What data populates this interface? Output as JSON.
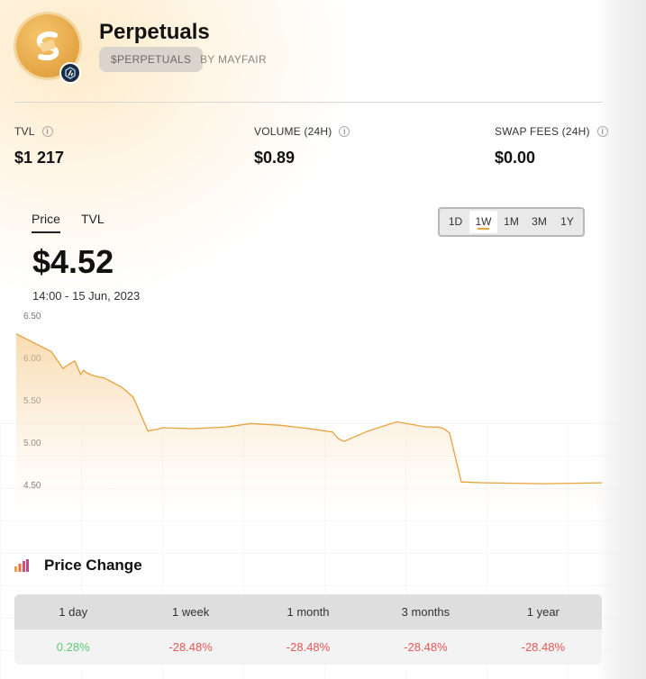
{
  "header": {
    "title": "Perpetuals",
    "ticker": "$PERPETUALS",
    "by": "BY MAYFAIR",
    "logo_icon": "perpetuals-logo",
    "chain_icon": "arbitrum-icon",
    "accent_color": "#e6a23c"
  },
  "stats": [
    {
      "label": "TVL",
      "value": "$1 217"
    },
    {
      "label": "VOLUME (24H)",
      "value": "$0.89"
    },
    {
      "label": "SWAP FEES (24H)",
      "value": "$0.00"
    }
  ],
  "chart_tabs": [
    "Price",
    "TVL"
  ],
  "ranges": [
    "1D",
    "1W",
    "1M",
    "3M",
    "1Y"
  ],
  "active_range": "1W",
  "price": {
    "current": "$4.52",
    "timestamp": "14:00 - 15 Jun, 2023"
  },
  "chart_data": {
    "type": "area",
    "y_ticks": [
      "6.50",
      "6.00",
      "5.50",
      "5.00",
      "4.50"
    ],
    "ylim": [
      4.45,
      6.55
    ],
    "xlabel": "",
    "ylabel": "",
    "line_color": "#e6a23c",
    "series": [
      {
        "x": [
          0,
          0.06,
          0.08,
          0.09,
          0.1,
          0.11,
          0.115,
          0.12,
          0.13,
          0.14,
          0.15,
          0.18,
          0.2,
          0.22,
          0.225,
          0.23,
          0.24,
          0.25,
          0.3,
          0.36,
          0.4,
          0.45,
          0.5,
          0.52,
          0.54,
          0.55,
          0.56,
          0.6,
          0.65,
          0.7,
          0.72,
          0.73,
          0.74,
          0.76,
          0.8,
          0.9,
          1.0
        ],
        "values": [
          6.28,
          6.07,
          5.87,
          5.92,
          5.96,
          5.8,
          5.85,
          5.82,
          5.79,
          5.77,
          5.76,
          5.65,
          5.53,
          5.21,
          5.13,
          5.14,
          5.15,
          5.17,
          5.16,
          5.18,
          5.22,
          5.2,
          5.16,
          5.14,
          5.12,
          5.04,
          5.01,
          5.13,
          5.24,
          5.18,
          5.18,
          5.16,
          5.11,
          4.53,
          4.52,
          4.51,
          4.52
        ]
      }
    ]
  },
  "price_change": {
    "title": "Price Change",
    "icon": "bar-chart-icon",
    "columns": [
      "1 day",
      "1 week",
      "1 month",
      "3 months",
      "1 year"
    ],
    "values": [
      {
        "text": "0.28%",
        "sign": "pos"
      },
      {
        "text": "-28.48%",
        "sign": "neg"
      },
      {
        "text": "-28.48%",
        "sign": "neg"
      },
      {
        "text": "-28.48%",
        "sign": "neg"
      },
      {
        "text": "-28.48%",
        "sign": "neg"
      }
    ]
  }
}
